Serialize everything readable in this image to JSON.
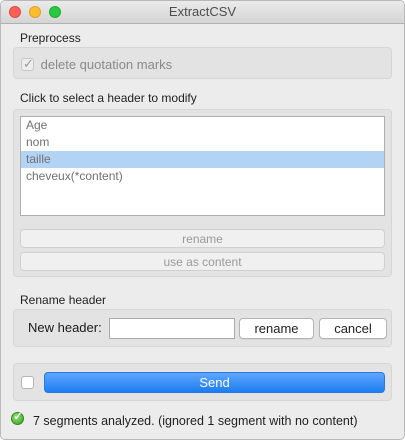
{
  "window": {
    "title": "ExtractCSV"
  },
  "preprocess": {
    "label": "Preprocess",
    "delete_quotes": {
      "label": "delete quotation marks",
      "checked": true
    }
  },
  "headers": {
    "label": "Click to select a header to modify",
    "items": [
      {
        "label": "Age",
        "selected": false
      },
      {
        "label": "nom",
        "selected": false
      },
      {
        "label": "taille",
        "selected": true
      },
      {
        "label": "cheveux(*content)",
        "selected": false
      }
    ],
    "rename_label": "rename",
    "use_as_content_label": "use as content"
  },
  "rename_header": {
    "label": "Rename header",
    "field_label": "New header:",
    "value": "",
    "rename_label": "rename",
    "cancel_label": "cancel"
  },
  "send": {
    "label": "Send",
    "auto_checked": false
  },
  "status": {
    "text": "7 segments analyzed. (ignored 1 segment with no content)"
  },
  "colors": {
    "accent": "#1c7df3",
    "selection": "#b3d3f5",
    "status_ok": "#3a9f1f"
  }
}
